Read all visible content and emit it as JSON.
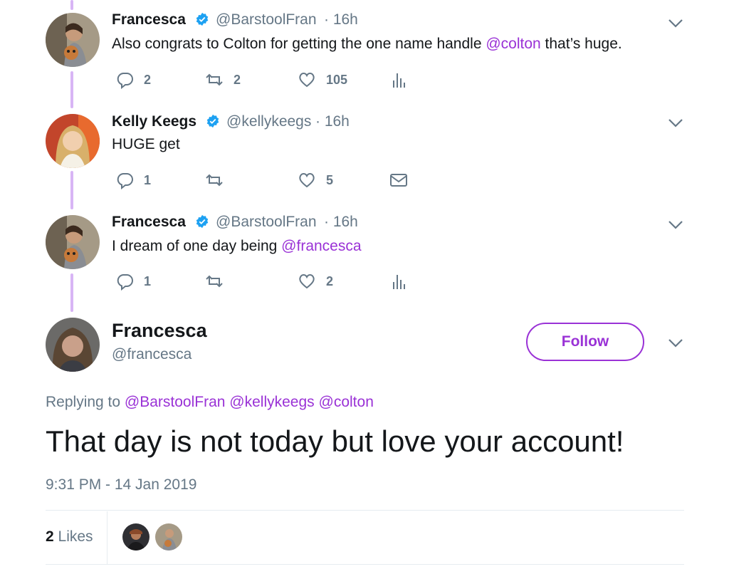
{
  "thread": [
    {
      "name": "Francesca",
      "handle": "@BarstoolFran",
      "time": "· 16h",
      "text_parts": [
        "Also congrats to Colton for getting the one name handle ",
        "@colton",
        " that’s huge."
      ],
      "replies": "2",
      "retweets": "2",
      "likes": "105",
      "extra_icon": "analytics-icon"
    },
    {
      "name": "Kelly Keegs",
      "handle": "@kellykeegs",
      "time": "· 16h",
      "text_parts": [
        "HUGE get"
      ],
      "replies": "1",
      "retweets": "",
      "likes": "5",
      "extra_icon": "mail-icon"
    },
    {
      "name": "Francesca",
      "handle": "@BarstoolFran",
      "time": "· 16h",
      "text_parts": [
        "I dream of one day being ",
        "@francesca"
      ],
      "replies": "1",
      "retweets": "",
      "likes": "2",
      "extra_icon": "analytics-icon"
    }
  ],
  "main_tweet": {
    "name": "Francesca",
    "handle": "@francesca",
    "follow_label": "Follow",
    "replying_prefix": "Replying to",
    "replying_to": [
      "@BarstoolFran",
      "@kellykeegs",
      "@colton"
    ],
    "text": "That day is not today but love your account!",
    "timestamp": "9:31 PM - 14 Jan 2019",
    "likes_count": "2",
    "likes_label": "Likes"
  },
  "colors": {
    "accent": "#9a32d6",
    "thread_line": "#d8b5f5",
    "muted": "#657786",
    "verified": "#1da1f2"
  }
}
